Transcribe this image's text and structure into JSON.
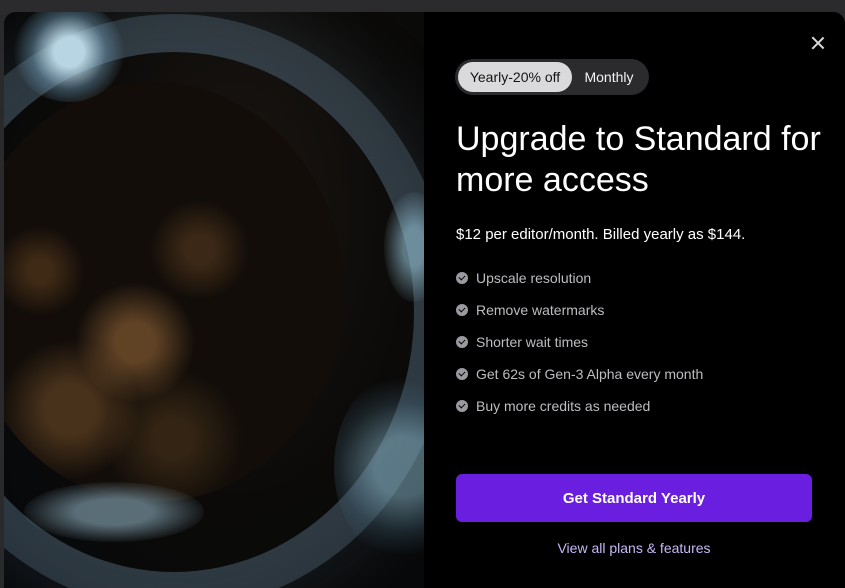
{
  "billing_toggle": {
    "options": [
      {
        "label": "Yearly-20% off",
        "selected": true
      },
      {
        "label": "Monthly",
        "selected": false
      }
    ]
  },
  "title": "Upgrade to Standard for more access",
  "price_text": "$12 per editor/month. Billed yearly as $144.",
  "features": [
    {
      "label": "Upscale resolution",
      "icon": "check-circle-icon"
    },
    {
      "label": "Remove watermarks",
      "icon": "check-circle-icon"
    },
    {
      "label": "Shorter wait times",
      "icon": "check-circle-icon"
    },
    {
      "label": "Get 62s of Gen-3 Alpha every month",
      "icon": "check-circle-icon"
    },
    {
      "label": "Buy more credits as needed",
      "icon": "check-circle-icon"
    }
  ],
  "cta_label": "Get Standard Yearly",
  "link_label": "View all plans & features",
  "close_icon": "close-icon",
  "colors": {
    "cta_background": "#6a1fe0",
    "link": "#c7b7f6",
    "panel_background": "#000000",
    "toggle_track": "#2b2b2e",
    "toggle_active": "#dadadc"
  }
}
